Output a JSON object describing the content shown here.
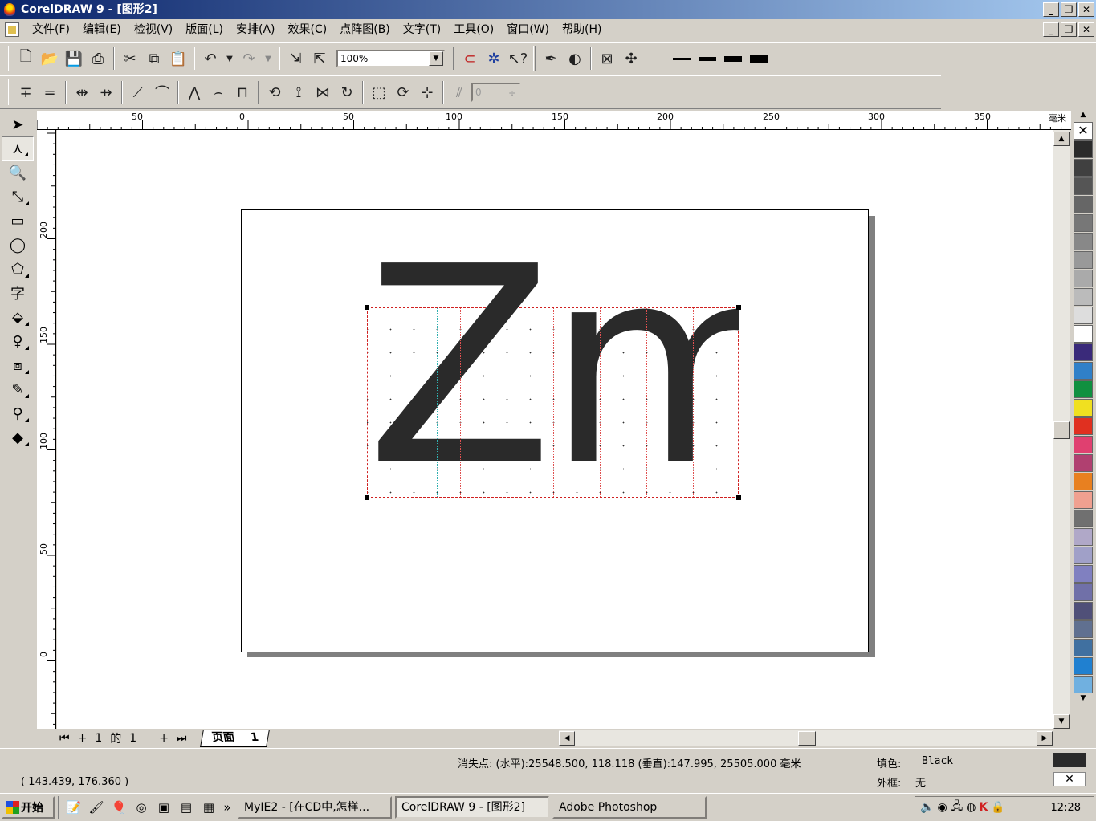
{
  "window": {
    "title": "CorelDRAW 9 - [图形2]"
  },
  "menu": [
    "文件(F)",
    "编辑(E)",
    "检视(V)",
    "版面(L)",
    "安排(A)",
    "效果(C)",
    "点阵图(B)",
    "文字(T)",
    "工具(O)",
    "窗口(W)",
    "帮助(H)"
  ],
  "toolbar": {
    "zoom": "100%",
    "nudge": "0"
  },
  "ruler": {
    "units": "毫米",
    "h_labels": [
      "50",
      "0",
      "50",
      "100",
      "150",
      "200",
      "250",
      "300",
      "350"
    ],
    "v_labels": [
      "200",
      "150",
      "100",
      "50",
      "0"
    ]
  },
  "document": {
    "text": "Zm"
  },
  "page_nav": {
    "current": "1",
    "of": "的",
    "total": "1",
    "tab": "页面",
    "tab_num": "1"
  },
  "status": {
    "coords": "( 143.439, 176.360 )",
    "vanishing": "消失点: (水平):25548.500, 118.118 (垂直):147.995, 25505.000 毫米",
    "fill_label": "填色:",
    "fill_value": "Black",
    "outline_label": "外框:",
    "outline_value": "无"
  },
  "taskbar": {
    "start": "开始",
    "tasks": [
      "MyIE2 - [在CD中,怎样...",
      "CorelDRAW 9 - [图形2]",
      "Adobe Photoshop"
    ],
    "clock": "12:28"
  },
  "palette": [
    "#2b2b2b",
    "#404040",
    "#555555",
    "#666666",
    "#777777",
    "#888888",
    "#999999",
    "#aaaaaa",
    "#bbbbbb",
    "#dddddd",
    "#ffffff",
    "#3a2a7a",
    "#3080c8",
    "#109040",
    "#f0e020",
    "#e03020",
    "#e04070",
    "#b04070",
    "#e88020",
    "#f0a090",
    "#707070",
    "#b0a8c8",
    "#a0a0c8",
    "#8080c0",
    "#7070a8",
    "#505078",
    "#607090",
    "#4070a0",
    "#2080d0",
    "#70b0e0"
  ],
  "colors": {
    "accent": "#0a246a",
    "text_fill": "#2a2a2a"
  }
}
